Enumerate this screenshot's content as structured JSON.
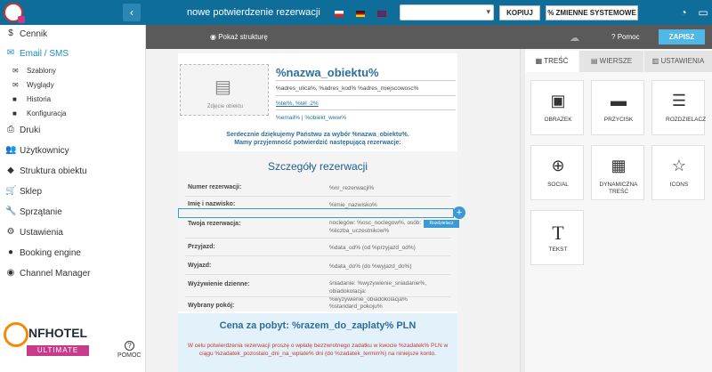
{
  "topbar": {
    "title": "nowe potwierdzenie rezerwacji",
    "select_value": "",
    "copy_label": "KOPIUJ",
    "vars_label": "ZMIENNE SYSTEMOWE",
    "collapse_icon": "chevron-left-icon"
  },
  "sidebar": {
    "items": [
      {
        "label": "Cennik",
        "icon": "dollar-icon"
      },
      {
        "label": "Email / SMS",
        "icon": "envelope-icon"
      },
      {
        "label": "Druki",
        "icon": "printer-icon"
      },
      {
        "label": "Użytkownicy",
        "icon": "users-icon"
      },
      {
        "label": "Struktura obiektu",
        "icon": "tags-icon"
      },
      {
        "label": "Sklep",
        "icon": "cart-icon"
      },
      {
        "label": "Sprzątanie",
        "icon": "wrench-icon"
      },
      {
        "label": "Ustawienia",
        "icon": "gears-icon"
      },
      {
        "label": "Booking engine",
        "icon": "globe-icon"
      },
      {
        "label": "Channel Manager",
        "icon": "share-icon"
      }
    ],
    "subitems": [
      {
        "label": "Szablony"
      },
      {
        "label": "Wyglądy"
      },
      {
        "label": "Historia"
      },
      {
        "label": "Konfiguracja"
      }
    ],
    "brand": "NFHOTEL",
    "brand_sub": "ULTIMATE",
    "help": "POMOC"
  },
  "editor": {
    "show_structure": "Pokaż strukturę",
    "help": "Pomoc",
    "save": "ZAPISZ"
  },
  "email": {
    "img_caption": "Zdjęcie obiektu",
    "hotel_name": "%nazwa_obiektu%",
    "address": "%adres_ulica%, %adres_kod% %adres_miejscowosc%",
    "tel": "%tel%, %tel_2%",
    "mail": "%email% | %obiekt_www%",
    "thanks1": "Serdecznie dziękujemy Państwu za wybór %nazwa_obiektu%.",
    "thanks2": "Mamy przyjemność potwierdzić następującą rezerwacje:",
    "details_title": "Szczegóły rezerwacji",
    "rows": [
      {
        "l": "Numer rezerwacji:",
        "v": "%nr_rezerwacji%"
      },
      {
        "l": "Imię i nazwisko:",
        "v": "%imie_nazwisko%"
      },
      {
        "l": "Twoja rezerwacja:",
        "v": "noclegów: %osc_noclegow%, osób: %liczba_uczestnikow%"
      },
      {
        "l": "Przyjazd:",
        "v": "%data_od% (od %przyjazd_od%)"
      },
      {
        "l": "Wyjazd:",
        "v": "%data_do% (do %wyjazd_do%)"
      },
      {
        "l": "Wyżywienie dzienne:",
        "v": "śniadanie: %wyzywienie_sniadanie%, obiadokolacja: %wyzywienie_obiadokolacja%"
      },
      {
        "l": "Wybrany pokój:",
        "v": "%standard_pokoju%"
      }
    ],
    "tooltip": "Rozdzielacz",
    "price_title": "Cena za pobyt: %razem_do_zaplaty% PLN",
    "price_desc": "W celu potwierdzenia rezerwacji proszę o wpłatę bezzwrotnego zadatku w kwocie %zadatek% PLN w ciągu %zadatek_pozostalo_dni_na_wplate% dni (do %zadatek_termin%) na niniejsze konto."
  },
  "panel": {
    "tabs": [
      "TREŚĆ",
      "WIERSZE",
      "USTAWIENIA"
    ],
    "blocks": [
      {
        "label": "OBRAZEK",
        "icon": "image-icon"
      },
      {
        "label": "PRZYCISK",
        "icon": "button-icon"
      },
      {
        "label": "ROZDZIELACZ",
        "icon": "divider-icon"
      },
      {
        "label": "SOCIAL",
        "icon": "plus-circle-icon"
      },
      {
        "label": "DYNAMICZNA TREŚĆ",
        "icon": "dynamic-icon"
      },
      {
        "label": "ICONS",
        "icon": "star-icon"
      },
      {
        "label": "TEKST",
        "icon": "text-icon"
      }
    ]
  }
}
